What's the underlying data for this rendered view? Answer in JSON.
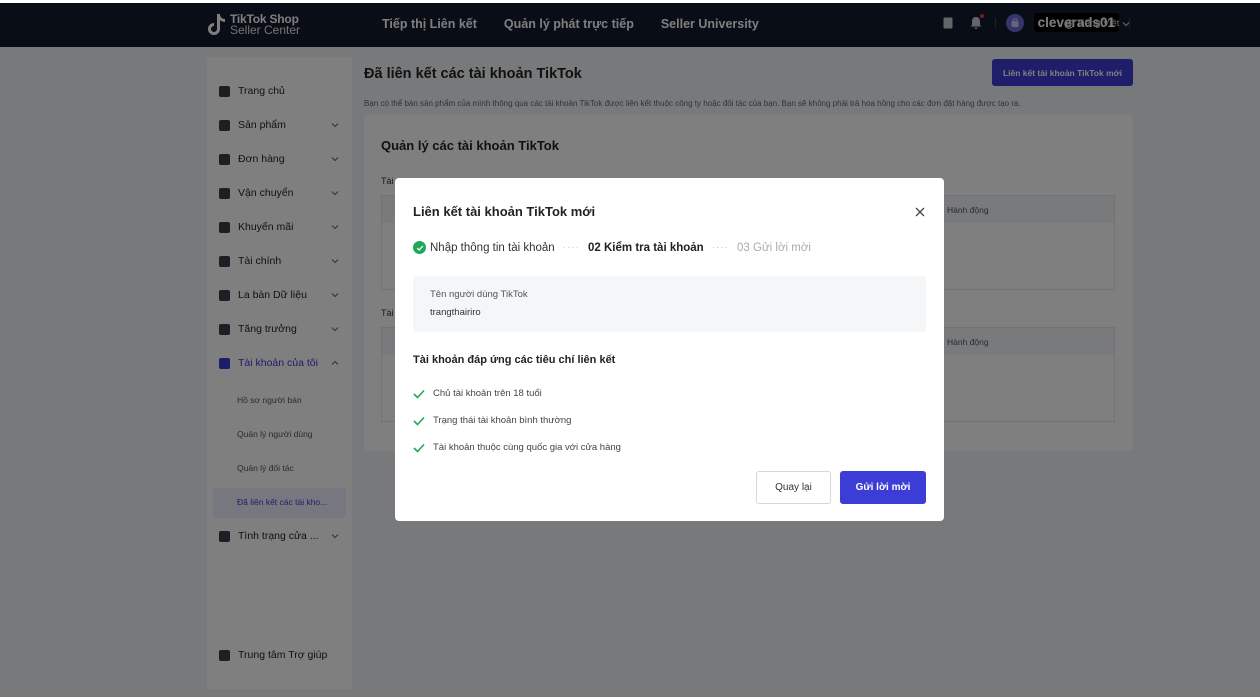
{
  "header": {
    "logo_line1": "TikTok Shop",
    "logo_line2": "Seller Center",
    "nav": [
      "Tiếp thị Liên kết",
      "Quản lý phát trực tiếp",
      "Seller University"
    ],
    "username": "cleverads01",
    "language": "Tiếng Việt"
  },
  "sidebar": {
    "items": [
      {
        "label": "Trang chủ",
        "icon": "home-icon"
      },
      {
        "label": "Sản phẩm",
        "icon": "product-icon"
      },
      {
        "label": "Đơn hàng",
        "icon": "order-icon"
      },
      {
        "label": "Vận chuyển",
        "icon": "truck-icon"
      },
      {
        "label": "Khuyến mãi",
        "icon": "megaphone-icon"
      },
      {
        "label": "Tài chính",
        "icon": "wallet-icon"
      },
      {
        "label": "La bàn Dữ liệu",
        "icon": "chart-icon"
      },
      {
        "label": "Tăng trưởng",
        "icon": "medal-icon"
      },
      {
        "label": "Tài khoản của tôi",
        "icon": "user-icon"
      }
    ],
    "subitems": [
      "Hồ sơ người bán",
      "Quản lý người dùng",
      "Quản lý đối tác",
      "Đã liên kết các tài kho..."
    ],
    "bottom_item": "Tình trạng cửa ...",
    "help": "Trung tâm Trợ giúp"
  },
  "main": {
    "title": "Đã liên kết các tài khoản TikTok",
    "link_button": "Liên kết tài khoản TikTok mới",
    "description": "Bạn có thể bán sản phẩm của mình thông qua các tài khoản TikTok được liên kết thuộc công ty hoặc đối tác của bạn. Bạn sẽ không phải trả hoa hồng cho các đơn đặt hàng được tạo ra.",
    "card_title": "Quản lý các tài khoản TikTok",
    "table_action_header": "Hành động"
  },
  "modal": {
    "title": "Liên kết tài khoản TikTok mới",
    "step1": "Nhập thông tin tài khoản",
    "step2": "02 Kiểm tra tài khoản",
    "step3": "03 Gửi lời mời",
    "username_label": "Tên người dùng TikTok",
    "username_value": "trangthairiro",
    "criteria_title": "Tài khoản đáp ứng các tiêu chí liên kết",
    "criteria": [
      "Chủ tài khoản trên 18 tuổi",
      "Trạng thái tài khoản bình thường",
      "Tài khoản thuộc cùng quốc gia với cửa hàng"
    ],
    "back_button": "Quay lại",
    "send_button": "Gửi lời mời"
  },
  "colors": {
    "primary": "#3c3cd6",
    "header_bg": "#121a2a",
    "success": "#1ea858"
  }
}
